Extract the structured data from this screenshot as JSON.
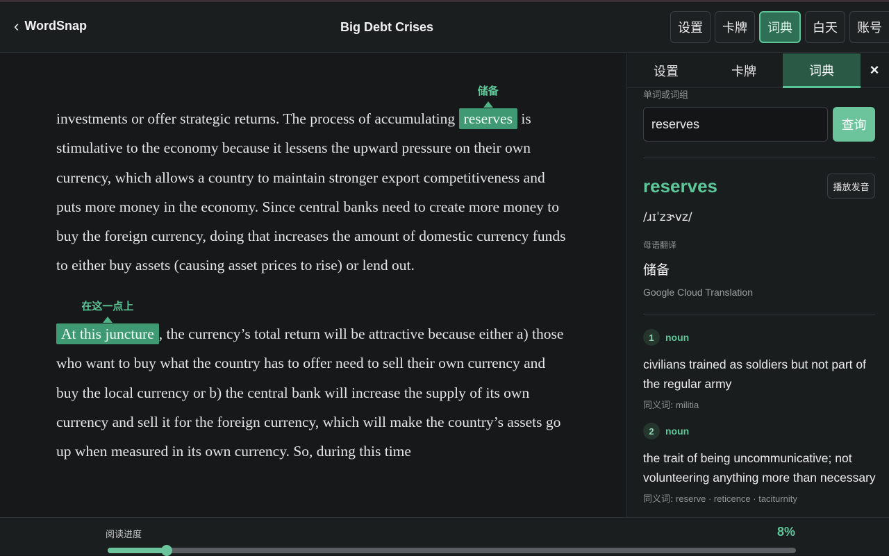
{
  "header": {
    "back_label": "WordSnap",
    "book_title": "Big Debt Crises",
    "buttons": [
      "设置",
      "卡牌",
      "词典",
      "白天",
      "账号"
    ],
    "active_button": "词典"
  },
  "reader": {
    "paragraph1": {
      "before": "investments or offer strategic returns. The process of accumulating ",
      "highlight": "reserves",
      "gloss": "储备",
      "after": " is stimulative to the economy because it lessens the upward pressure on their own currency, which allows a country to maintain stronger export competitiveness and puts more money in the economy. Since central banks need to create more money to buy the foreign currency, doing that increases the amount of domestic currency funds to either buy assets (causing asset prices to rise) or lend out."
    },
    "paragraph2": {
      "highlight": "At this juncture",
      "gloss": "在这一点上",
      "after": ", the currency’s total return will be attractive because either a) those who want to buy what the country has to offer need to sell their own currency and buy the local currency or b) the central bank will increase the supply of its own currency and sell it for the foreign currency, which will make the country’s assets go up when measured in its own currency. So, during this time"
    }
  },
  "panel": {
    "tabs": [
      "设置",
      "卡牌",
      "词典"
    ],
    "active_tab": "词典",
    "close_icon": "×",
    "input_label": "单词或词组",
    "input_value": "reserves",
    "query_label": "查询",
    "word": "reserves",
    "play_label": "播放发音",
    "ipa": "/ɹɪˈzɝvz/",
    "native_label": "母语翻译",
    "translation": "储备",
    "source": "Google Cloud Translation",
    "senses": [
      {
        "num": "1",
        "pos": "noun",
        "definition": "civilians trained as soldiers but not part of the regular army",
        "synonyms_label": "同义词:",
        "synonyms": "militia"
      },
      {
        "num": "2",
        "pos": "noun",
        "definition": "the trait of being uncommunicative; not volunteering anything more than necessary",
        "synonyms_label": "同义词:",
        "synonyms": "reserve · reticence · taciturnity"
      }
    ]
  },
  "footer": {
    "progress_label": "阅读进度",
    "progress_text": "8%",
    "progress_value": 0.086
  },
  "colors": {
    "accent": "#5ec79a",
    "highlight_bg": "#3f9a73",
    "background": "#161819"
  }
}
